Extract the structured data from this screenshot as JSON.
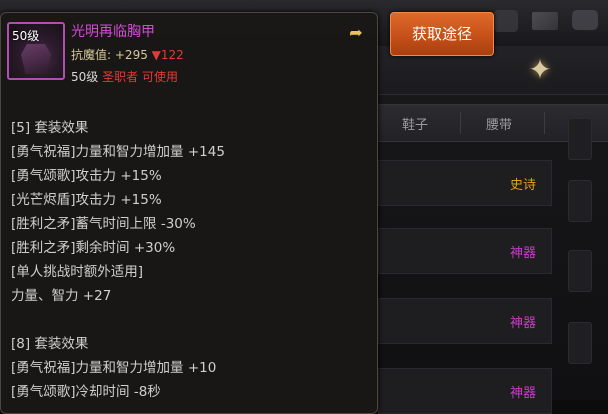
{
  "item": {
    "level_badge": "50级",
    "name": "光明再临胸甲",
    "resistance_label": "抗魔值:",
    "resistance_value": "+295",
    "resistance_change": "▼122",
    "requirement_level": "50级",
    "requirement_job": "圣职者",
    "requirement_status": "可使用"
  },
  "tooltip_lines": [
    "[5] 套装效果",
    "[勇气祝福]力量和智力增加量 +145",
    "[勇气颂歌]攻击力 +15%",
    "[光芒烬盾]攻击力 +15%",
    "[胜利之矛]蓄气时间上限 -30%",
    "[胜利之矛]剩余时间 +30%",
    "[单人挑战时额外适用]",
    "力量、智力 +27",
    "",
    "[8] 套装效果",
    "[勇气祝福]力量和智力增加量 +10",
    "[勇气颂歌]冷却时间 -8秒"
  ],
  "button": {
    "get_route": "获取途径"
  },
  "background": {
    "columns": [
      "鞋子",
      "腰带"
    ],
    "row_tags": [
      "史诗",
      "神器",
      "神器",
      "神器"
    ]
  },
  "colors": {
    "item_name": "#d44ad6",
    "epic": "#e0a020",
    "artifact": "#c83cc8",
    "button": "#c34e18",
    "negative": "#e23a3a"
  }
}
